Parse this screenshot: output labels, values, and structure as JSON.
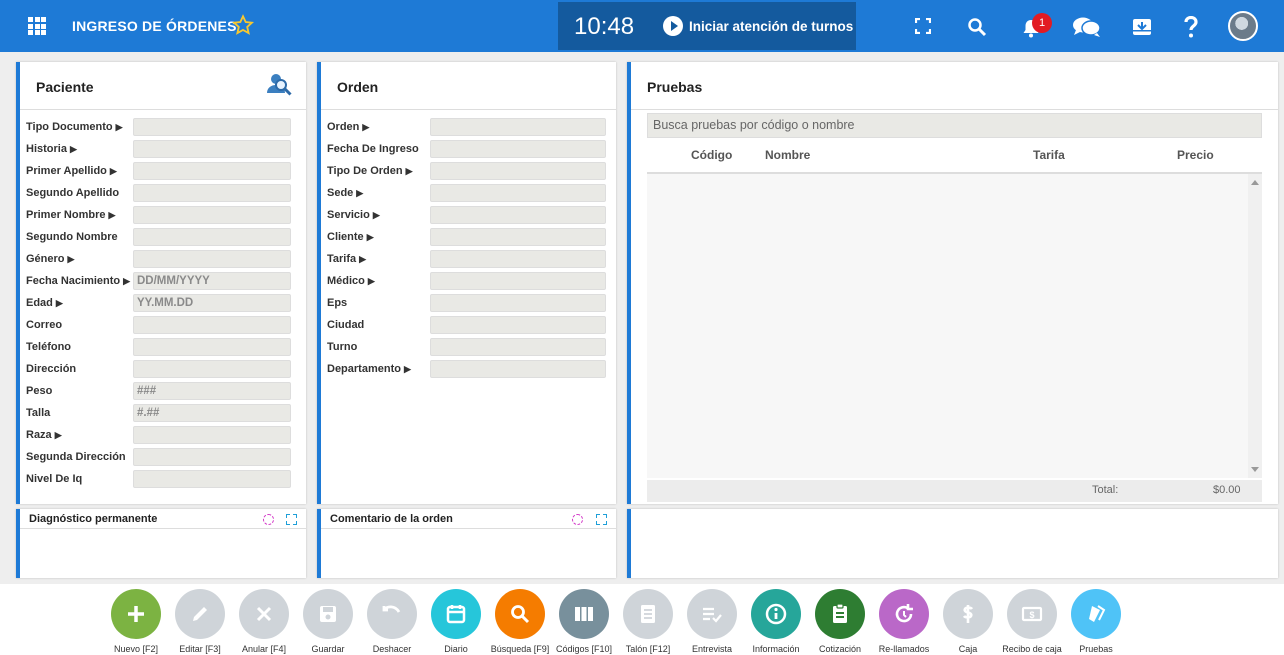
{
  "header": {
    "title": "INGRESO DE ÓRDENES",
    "time": "10:48",
    "turnos_label": "Iniciar atención de turnos",
    "notifications_count": "1"
  },
  "paciente": {
    "title": "Paciente",
    "fields": [
      {
        "label": "Tipo Documento",
        "arrow": true,
        "value": ""
      },
      {
        "label": "Historia",
        "arrow": true,
        "value": ""
      },
      {
        "label": "Primer Apellido",
        "arrow": true,
        "value": ""
      },
      {
        "label": "Segundo Apellido",
        "arrow": false,
        "value": ""
      },
      {
        "label": "Primer Nombre",
        "arrow": true,
        "value": ""
      },
      {
        "label": "Segundo Nombre",
        "arrow": false,
        "value": ""
      },
      {
        "label": "Género",
        "arrow": true,
        "value": ""
      },
      {
        "label": "Fecha Nacimiento",
        "arrow": true,
        "value": "DD/MM/YYYY"
      },
      {
        "label": "Edad",
        "arrow": true,
        "value": "YY.MM.DD"
      },
      {
        "label": "Correo",
        "arrow": false,
        "value": ""
      },
      {
        "label": "Teléfono",
        "arrow": false,
        "value": ""
      },
      {
        "label": "Dirección",
        "arrow": false,
        "value": ""
      },
      {
        "label": "Peso",
        "arrow": false,
        "value": "###"
      },
      {
        "label": "Talla",
        "arrow": false,
        "value": "#.##"
      },
      {
        "label": "Raza",
        "arrow": true,
        "value": ""
      },
      {
        "label": "Segunda Dirección",
        "arrow": false,
        "value": ""
      },
      {
        "label": "Nivel De Iq",
        "arrow": false,
        "value": ""
      }
    ]
  },
  "orden": {
    "title": "Orden",
    "fields": [
      {
        "label": "Orden",
        "arrow": true,
        "value": ""
      },
      {
        "label": "Fecha De Ingreso",
        "arrow": false,
        "value": ""
      },
      {
        "label": "Tipo De Orden",
        "arrow": true,
        "value": ""
      },
      {
        "label": "Sede",
        "arrow": true,
        "value": ""
      },
      {
        "label": "Servicio",
        "arrow": true,
        "value": ""
      },
      {
        "label": "Cliente",
        "arrow": true,
        "value": ""
      },
      {
        "label": "Tarifa",
        "arrow": true,
        "value": ""
      },
      {
        "label": "Médico",
        "arrow": true,
        "value": ""
      },
      {
        "label": "Eps",
        "arrow": false,
        "value": ""
      },
      {
        "label": "Ciudad",
        "arrow": false,
        "value": ""
      },
      {
        "label": "Turno",
        "arrow": false,
        "value": ""
      },
      {
        "label": "Departamento",
        "arrow": true,
        "value": ""
      }
    ]
  },
  "pruebas": {
    "title": "Pruebas",
    "search_placeholder": "Busca pruebas por código o nombre",
    "columns": [
      "Código",
      "Nombre",
      "Tarifa",
      "Precio"
    ],
    "total_label": "Total:",
    "total_value": "$0.00"
  },
  "diagnostico": {
    "title": "Diagnóstico permanente"
  },
  "comentario": {
    "title": "Comentario de la orden"
  },
  "toolbar": {
    "buttons": [
      {
        "label": "Nuevo [F2]",
        "icon": "plus-icon",
        "color": "#7cb342"
      },
      {
        "label": "Editar [F3]",
        "icon": "pencil-icon",
        "color": "#cfd4d9"
      },
      {
        "label": "Anular [F4]",
        "icon": "close-icon",
        "color": "#cfd4d9"
      },
      {
        "label": "Guardar",
        "icon": "save-icon",
        "color": "#cfd4d9"
      },
      {
        "label": "Deshacer",
        "icon": "undo-icon",
        "color": "#cfd4d9"
      },
      {
        "label": "Diario",
        "icon": "calendar-icon",
        "color": "#26c6da"
      },
      {
        "label": "Búsqueda [F9]",
        "icon": "search-icon",
        "color": "#f57c00"
      },
      {
        "label": "Códigos [F10]",
        "icon": "columns-icon",
        "color": "#78909c"
      },
      {
        "label": "Talón [F12]",
        "icon": "document-icon",
        "color": "#cfd4d9"
      },
      {
        "label": "Entrevista",
        "icon": "checklist-icon",
        "color": "#cfd4d9"
      },
      {
        "label": "Información",
        "icon": "info-icon",
        "color": "#26a69a"
      },
      {
        "label": "Cotización",
        "icon": "clipboard-icon",
        "color": "#2e7d32"
      },
      {
        "label": "Re-llamados",
        "icon": "refresh-icon",
        "color": "#ba68c8"
      },
      {
        "label": "Caja",
        "icon": "dollar-icon",
        "color": "#cfd4d9"
      },
      {
        "label": "Recibo de caja",
        "icon": "receipt-icon",
        "color": "#cfd4d9"
      },
      {
        "label": "Pruebas",
        "icon": "tubes-icon",
        "color": "#4fc3f7"
      }
    ]
  }
}
